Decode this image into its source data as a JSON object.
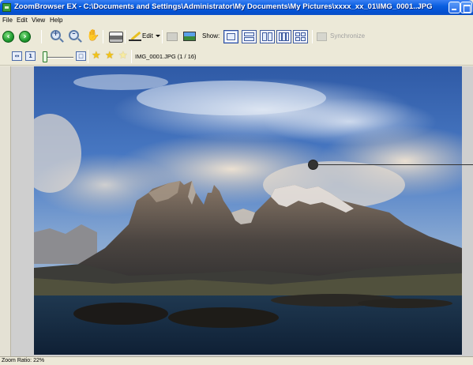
{
  "window": {
    "title": "ZoomBrowser EX - C:\\Documents and Settings\\Administrator\\My Documents\\My Pictures\\xxxx_xx_01\\IMG_0001..JPG"
  },
  "menu": {
    "items": [
      {
        "label": "File"
      },
      {
        "label": "Edit"
      },
      {
        "label": "View"
      },
      {
        "label": "Help"
      }
    ]
  },
  "toolbar": {
    "back_icon": "back-arrow-icon",
    "forward_icon": "forward-arrow-icon",
    "zoom_in_icon": "zoom-in-icon",
    "zoom_out_icon": "zoom-out-icon",
    "hand_icon": "hand-tool-icon",
    "print_icon": "printer-icon",
    "edit_label": "Edit",
    "show_label": "Show:",
    "synchronize_label": "Synchronize",
    "view_layouts": [
      {
        "name": "single",
        "active": true
      },
      {
        "name": "split-horizontal",
        "active": false
      },
      {
        "name": "split-vertical",
        "active": false
      },
      {
        "name": "three-columns",
        "active": false
      },
      {
        "name": "four-panes",
        "active": false
      }
    ]
  },
  "toolbar2": {
    "fit_icon": "fit-to-window-icon",
    "actual_size_icon": "actual-size-icon",
    "zoom_slider_position": 0.0,
    "rating": 2,
    "rating_max": 3,
    "file_info": "IMG_0001.JPG (1 / 16)"
  },
  "status": {
    "zoom_ratio": "Zoom Ratio: 22%"
  },
  "colors": {
    "title_bar": "#0a5fe0",
    "chrome": "#ece9d8",
    "viewer_bg": "#cfcfcf",
    "star": "#f2c417"
  }
}
